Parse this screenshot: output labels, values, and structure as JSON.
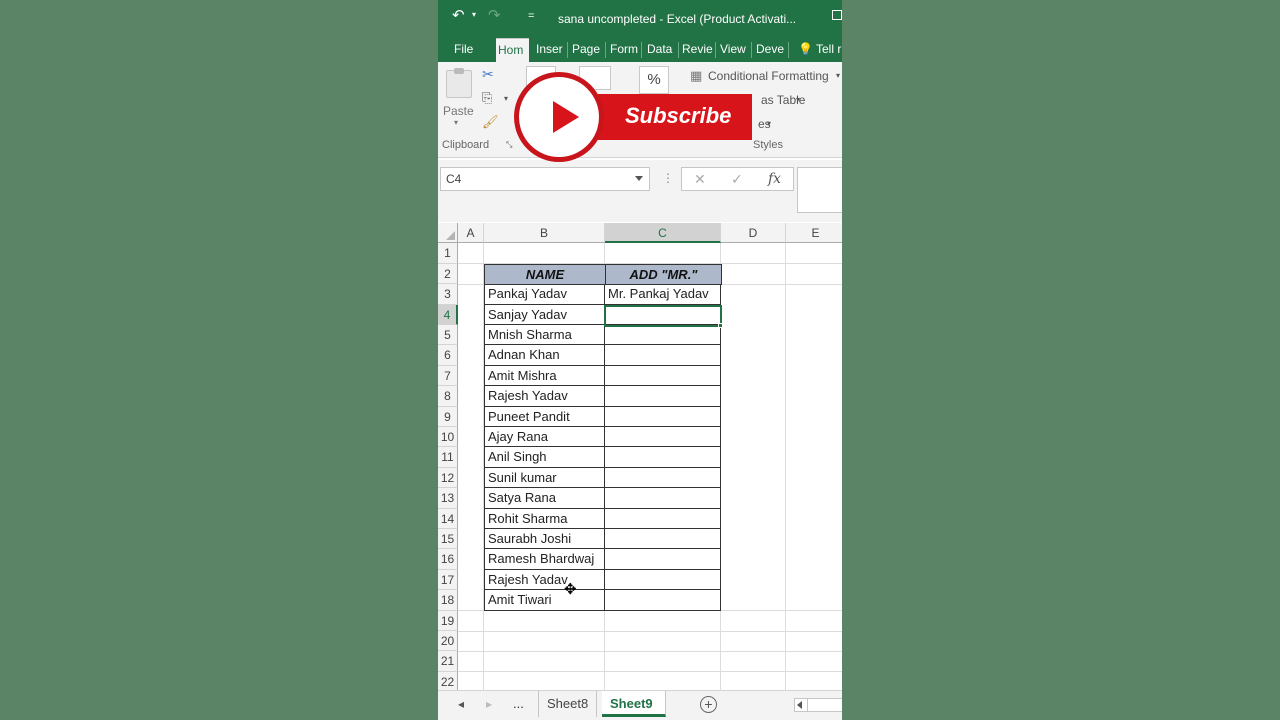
{
  "window": {
    "title": "sana uncompleted - Excel (Product Activati...",
    "undo_icon": "↶",
    "redo_icon": "↷",
    "qat_more": "="
  },
  "ribbon_tabs": [
    "File",
    "Hom",
    "Inser",
    "Page",
    "Form",
    "Data",
    "Revie",
    "View",
    "Deve"
  ],
  "tell_me": "Tell r",
  "ribbon": {
    "paste_label": "Paste",
    "percent": "%",
    "conditional_formatting": "Conditional Formatting",
    "format_as_table": "as Table",
    "cell_styles": "es",
    "clipboard_label": "Clipboard",
    "styles_label": "Styles"
  },
  "overlay": {
    "subscribe": "Subscribe"
  },
  "formula_bar": {
    "name_box": "C4",
    "cancel": "✕",
    "enter": "✓",
    "fx": "fx",
    "formula": ""
  },
  "columns": [
    "A",
    "B",
    "C",
    "D",
    "E"
  ],
  "rows": [
    "1",
    "2",
    "3",
    "4",
    "5",
    "6",
    "7",
    "8",
    "9",
    "10",
    "11",
    "12",
    "13",
    "14",
    "15",
    "16",
    "17",
    "18",
    "19",
    "20",
    "21",
    "22"
  ],
  "table": {
    "headers": [
      "NAME",
      "ADD \"MR.\""
    ],
    "rows": [
      [
        "Pankaj Yadav",
        "Mr. Pankaj Yadav"
      ],
      [
        "Sanjay Yadav",
        ""
      ],
      [
        "Mnish Sharma",
        ""
      ],
      [
        "Adnan Khan",
        ""
      ],
      [
        "Amit Mishra",
        ""
      ],
      [
        "Rajesh Yadav",
        ""
      ],
      [
        "Puneet Pandit",
        ""
      ],
      [
        "Ajay Rana",
        ""
      ],
      [
        "Anil Singh",
        ""
      ],
      [
        "Sunil kumar",
        ""
      ],
      [
        "Satya Rana",
        ""
      ],
      [
        "Rohit Sharma",
        ""
      ],
      [
        "Saurabh Joshi",
        ""
      ],
      [
        "Ramesh Bhardwaj",
        ""
      ],
      [
        "Rajesh Yadav",
        ""
      ],
      [
        "Amit Tiwari",
        ""
      ]
    ]
  },
  "sheets": {
    "more": "...",
    "tabs": [
      "Sheet8",
      "Sheet9"
    ],
    "active": "Sheet9",
    "add": "+"
  },
  "colors": {
    "excel_green": "#217346",
    "header_fill": "#adb9ca",
    "youtube_red": "#d8141b"
  }
}
